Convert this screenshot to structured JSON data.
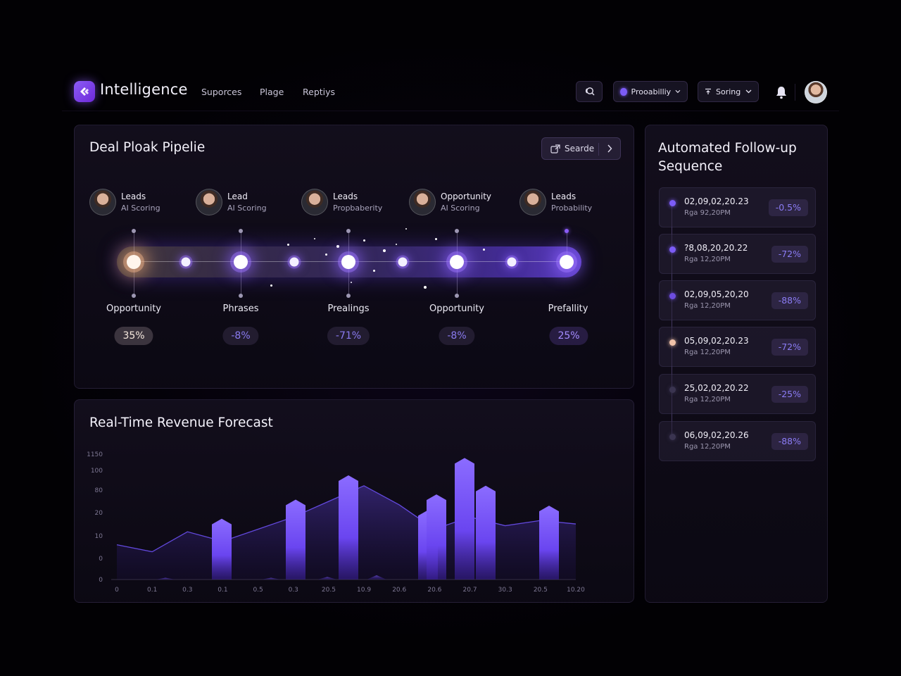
{
  "header": {
    "brand": "Intelligence",
    "nav": [
      "Suporces",
      "Plage",
      "Reptiys"
    ],
    "probability_label": "Prooabilliy",
    "sort_label": "Soring"
  },
  "pipeline": {
    "title": "Deal Ploak Pipelie",
    "search_label": "Searde",
    "stages": [
      {
        "name": "Leads",
        "sub": "AI Scoring",
        "label": "Opportunity",
        "pct": "35%"
      },
      {
        "name": "Lead",
        "sub": "AI Scoring",
        "label": "Phrases",
        "pct": "-8%"
      },
      {
        "name": "Leads",
        "sub": "Propbaberity",
        "label": "Prealings",
        "pct": "-71%"
      },
      {
        "name": "Opportunity",
        "sub": "AI Scoring",
        "label": "Opportunity",
        "pct": "-8%"
      },
      {
        "name": "Leads",
        "sub": "Probability",
        "label": "Prefallity",
        "pct": "25%"
      }
    ]
  },
  "revenue": {
    "title": "Real-Time Revenue Forecast"
  },
  "sequence": {
    "title_line1": "Automated Follow-up",
    "title_line2": "Sequence",
    "items": [
      {
        "date": "02,09,02,20.23",
        "sub": "Rga 92,20PM",
        "badge": "-0.5%",
        "dot": "#7c5cf6"
      },
      {
        "date": "?8,08,20,20.22",
        "sub": "Rga 12,20PM",
        "badge": "-72%",
        "dot": "#7c5cf6"
      },
      {
        "date": "02,09,05,20,20",
        "sub": "Rga 12,20PM",
        "badge": "-88%",
        "dot": "#6d4de0"
      },
      {
        "date": "05,09,02,20.23",
        "sub": "Rga 12,20PM",
        "badge": "-72%",
        "dot": "#f0c2a8"
      },
      {
        "date": "25,02,02,20.22",
        "sub": "Rga 12,20PM",
        "badge": "-25%",
        "dot": "#3a3450"
      },
      {
        "date": "06,09,02,20.26",
        "sub": "Rga 12,20PM",
        "badge": "-88%",
        "dot": "#3a3450"
      }
    ]
  },
  "chart_data": {
    "type": "bar",
    "title": "Real-Time Revenue Forecast",
    "y_ticks": [
      "1150",
      "100",
      "80",
      "20",
      "10",
      "0",
      "0"
    ],
    "categories": [
      "0",
      "0.1",
      "0.3",
      "0.1",
      "0.5",
      "0.3",
      "20.5",
      "10.9",
      "20.6",
      "20.6",
      "20.7",
      "30.3",
      "20.5",
      "10.20"
    ],
    "bars": [
      {
        "x": "0.1",
        "value": 2
      },
      {
        "x": "0.3",
        "value": 70
      },
      {
        "x": "0.5",
        "value": 2
      },
      {
        "x": "0.3",
        "value": 92
      },
      {
        "x": "0.3",
        "value": 3
      },
      {
        "x": "20.5",
        "value": 120
      },
      {
        "x": "10.9",
        "value": 5
      },
      {
        "x": "20.6",
        "value": 80
      },
      {
        "x": "20.7",
        "value": 98
      },
      {
        "x": "20.7",
        "value": 140
      },
      {
        "x": "30.3",
        "value": 108
      },
      {
        "x": "20.5",
        "value": 85
      }
    ],
    "line_values": [
      40,
      32,
      55,
      44,
      58,
      72,
      90,
      108,
      86,
      58,
      72,
      62,
      68,
      64
    ]
  }
}
